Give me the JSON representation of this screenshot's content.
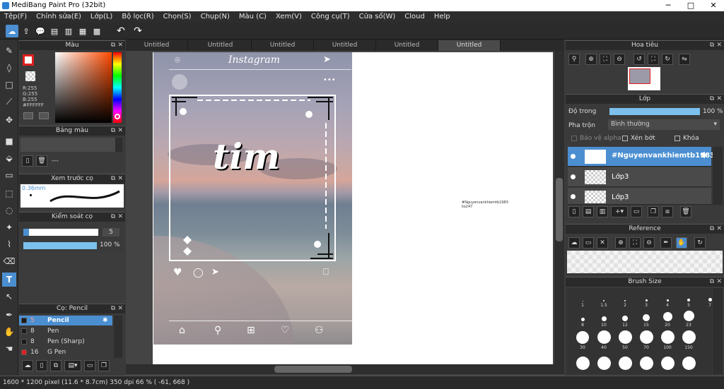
{
  "window": {
    "title": "MediBang Paint Pro (32bit)"
  },
  "menu": [
    "Tệp(F)",
    "Chỉnh sửa(E)",
    "Lớp(L)",
    "Bộ lọc(R)",
    "Chọn(S)",
    "Chụp(N)",
    "Màu (C)",
    "Xem(V)",
    "Công cụ(T)",
    "Cửa sổ(W)",
    "Cloud",
    "Help"
  ],
  "tabs": [
    "Untitled",
    "Untitled",
    "Untitled",
    "Untitled",
    "Untitled",
    "Untitled"
  ],
  "color_panel": {
    "title": "Màu",
    "r": "R:255",
    "g": "G:255",
    "b": "B:255",
    "hex": "#FFFFFF"
  },
  "palette_panel": {
    "title": "Bảng màu",
    "dash": "---"
  },
  "preview_panel": {
    "title": "Xem trước cọ",
    "size": "0.36mm"
  },
  "brush_control": {
    "title": "Kiểm soát cọ",
    "size": "5",
    "opacity": "100 %"
  },
  "brush_panel": {
    "title": "Cọ: Pencil",
    "items": [
      {
        "num": "5",
        "name": "Pencil",
        "color": "#1a1a1a"
      },
      {
        "num": "8",
        "name": "Pen",
        "color": "#1a1a1a"
      },
      {
        "num": "8",
        "name": "Pen (Sharp)",
        "color": "#1a1a1a"
      },
      {
        "num": "16",
        "name": "G Pen",
        "color": "#e02020"
      }
    ]
  },
  "canvas": {
    "ig_title": "Instagram",
    "overlay_word": "tim",
    "watermark_line1": "#Nguyenvankhiemtb1983",
    "watermark_line2": "ko247"
  },
  "navigator_panel": {
    "title": "Hoa tiêu"
  },
  "layer_panel": {
    "title": "Lớp",
    "opacity_label": "Độ trong",
    "opacity_value": "100 %",
    "blend_label": "Pha trộn",
    "blend_value": "Bình thường",
    "protect_alpha": "Bảo vệ alpha",
    "clipping": "Xén bớt",
    "lock": "Khóa",
    "layers": [
      {
        "name": "#Nguyenvankhiemtb1983",
        "selected": true
      },
      {
        "name": "Lớp3",
        "selected": false
      },
      {
        "name": "Lớp3",
        "selected": false
      }
    ]
  },
  "reference_panel": {
    "title": "Reference"
  },
  "brush_size_panel": {
    "title": "Brush Size",
    "rows": [
      [
        "1",
        "1.5",
        "2",
        "3",
        "4",
        "5",
        "7"
      ],
      [
        "8",
        "10",
        "12",
        "15",
        "20",
        "23"
      ],
      [
        "30",
        "40",
        "50",
        "70",
        "100",
        "150"
      ],
      []
    ]
  },
  "status": {
    "text": "1600 * 1200 pixel   (11.6 * 8.7cm)   350 dpi   66 %   ( -61, 668 )"
  },
  "colors": {
    "accent": "#4b8fd1",
    "bg": "#3a3a3a"
  }
}
